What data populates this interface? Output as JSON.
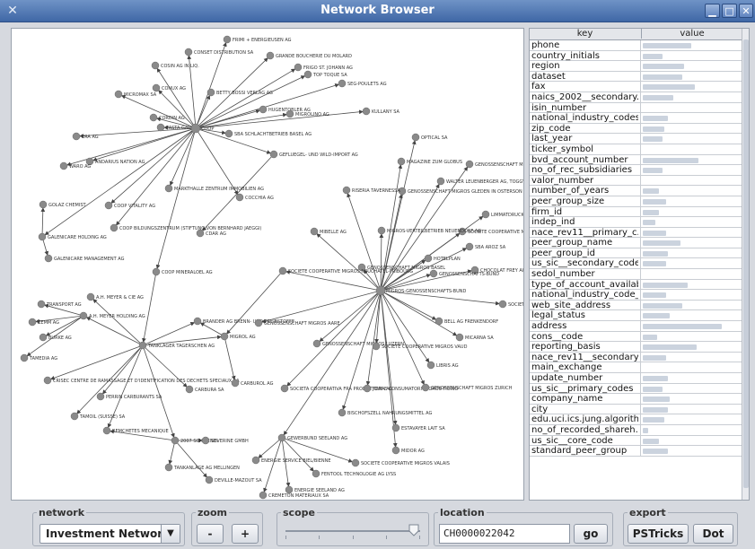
{
  "window": {
    "title": "Network Browser",
    "icon": "network-icon",
    "controls": [
      "minimize-icon",
      "maximize-icon",
      "close-icon"
    ]
  },
  "graph": {
    "nodes": [
      {
        "id": "n1",
        "label": "CONSET DISTRIBUTION SA"
      },
      {
        "id": "n2",
        "label": "FRIMI + ENERGIEUSEN AG"
      },
      {
        "id": "n3",
        "label": "COSIN AG IN LIQ."
      },
      {
        "id": "n4",
        "label": "GRANDE BOUCHERIE DU MOLARD"
      },
      {
        "id": "n5",
        "label": "FRIGO ST. JOHANN AG"
      },
      {
        "id": "n6",
        "label": "TOP TOQUE SA"
      },
      {
        "id": "n7",
        "label": "CONUX AG"
      },
      {
        "id": "n8",
        "label": "BETTY BOSSI VERLAG AG"
      },
      {
        "id": "n9",
        "label": "SEG-POULETS AG"
      },
      {
        "id": "n10",
        "label": "MICROMAX SA"
      },
      {
        "id": "n11",
        "label": "CORDIN AG"
      },
      {
        "id": "n12",
        "label": "PASTA GALA SA"
      },
      {
        "id": "n13",
        "label": "COOP"
      },
      {
        "id": "n14",
        "label": "HUGENTOBLER AG"
      },
      {
        "id": "n15",
        "label": "KULLANY SA"
      },
      {
        "id": "n16",
        "label": "MIGROLINO AG"
      },
      {
        "id": "n17",
        "label": "ERA AG"
      },
      {
        "id": "n18",
        "label": "SBA SCHLACHTBETRIEB BASEL AG"
      },
      {
        "id": "n19",
        "label": "OPTICAL SA"
      },
      {
        "id": "n20",
        "label": "ANDARIUS NATION AG"
      },
      {
        "id": "n21",
        "label": "WARO AG"
      },
      {
        "id": "n22",
        "label": "GEFLUEGEL- UND WILD-IMPORT AG"
      },
      {
        "id": "n23",
        "label": "MAGAZINE ZUM GLOBUS"
      },
      {
        "id": "n24",
        "label": "GENOSSENSCHAFT MIGROS OSTSCHWEIZ"
      },
      {
        "id": "n25",
        "label": "MARKTHALLE ZENTRUM IMMOBILIEN AG"
      },
      {
        "id": "n26",
        "label": "WALTER LEUENBERGER AG, TOGGWIL"
      },
      {
        "id": "n27",
        "label": "GENOSSENSCHAFT MIGROS GLEDEN IN OSTERSON"
      },
      {
        "id": "n28",
        "label": "RISERIA TAVERNESSA"
      },
      {
        "id": "n29",
        "label": "COCCHIA AG"
      },
      {
        "id": "n30",
        "label": "GOLAZ CHEMIST"
      },
      {
        "id": "n31",
        "label": "COOP VITALITY AG"
      },
      {
        "id": "n32",
        "label": "LIMMATDRUCK AG"
      },
      {
        "id": "n33",
        "label": "COOP BILDUNGSZENTRUM (STIFTUNG VON BERNHARD JAEGGI)"
      },
      {
        "id": "n34",
        "label": "CDAR AG"
      },
      {
        "id": "n35",
        "label": "GALENICARE HOLDING AG"
      },
      {
        "id": "n36",
        "label": "SOCIETE COOPERATIVE MIGROS GENEVE"
      },
      {
        "id": "n37",
        "label": "MIGROS-VERTEILBETRIEB NEUENDORF AG"
      },
      {
        "id": "n38",
        "label": "GALENICARE MANAGEMENT AG"
      },
      {
        "id": "n39",
        "label": "SBA AROZ SA"
      },
      {
        "id": "n40",
        "label": "MIBELLE AG"
      },
      {
        "id": "n41",
        "label": "COOP MINERALOEL AG"
      },
      {
        "id": "n42",
        "label": "HOTELPLAN"
      },
      {
        "id": "n43",
        "label": "CHOCOLAT FREY AG"
      },
      {
        "id": "n44",
        "label": "GENOSSENSCHAFT MIGROS BASEL"
      },
      {
        "id": "n45",
        "label": "GENOSSENSCHAFTS-BUND"
      },
      {
        "id": "n46",
        "label": "MIGROS-GENOSSENSCHAFTS-BUND"
      },
      {
        "id": "n47",
        "label": "TRANSPORT AG"
      },
      {
        "id": "n48",
        "label": "A.H. MEYER & CIE AG"
      },
      {
        "id": "n49",
        "label": "SOCIETE COOPERATIVE MIGROS NEUCHATEL-FRIBOURG"
      },
      {
        "id": "n50",
        "label": "ZEMM AG"
      },
      {
        "id": "n51",
        "label": "A.H. MEYER HOLDING AG"
      },
      {
        "id": "n52",
        "label": "BELL AG FRENKENDORF"
      },
      {
        "id": "n53",
        "label": "BURKE AG"
      },
      {
        "id": "n54",
        "label": "BRANDER AG BRENN- UND TREIBSTOFFE"
      },
      {
        "id": "n55",
        "label": "GENOSSENSCHAFT MIGROS AARE"
      },
      {
        "id": "n56",
        "label": "MICARNA SA"
      },
      {
        "id": "n57",
        "label": "TAMEDIA AG"
      },
      {
        "id": "n58",
        "label": "TANKLAGER TAGERSCHEN AG"
      },
      {
        "id": "n59",
        "label": "MIGROL AG"
      },
      {
        "id": "n60",
        "label": "GENOSSENSCHAFT MIGROS LUZERN"
      },
      {
        "id": "n61",
        "label": "SOCIETE COOPERATIVE MIGROS VAUD"
      },
      {
        "id": "n62",
        "label": "LIBRIS AG"
      },
      {
        "id": "n63",
        "label": "CRISEC CENTRE DE RAMASSAGE ET D'IDENTIFICATION DES DECHETS SPECIAUX SA"
      },
      {
        "id": "n64",
        "label": "CARBURA SA"
      },
      {
        "id": "n65",
        "label": "CARBUROL AG"
      },
      {
        "id": "n66",
        "label": "SOCIETA COOPERATIVA FRA PRODUTTORI E CONSUMATORI MIGROS-TICINO"
      },
      {
        "id": "n67",
        "label": "JOWA AG"
      },
      {
        "id": "n68",
        "label": "GENOSSENSCHAFT MIGROS ZURICH"
      },
      {
        "id": "n69",
        "label": "PERRIN CARBURANTS SA"
      },
      {
        "id": "n70",
        "label": "TAMOIL (SUISSE) SA"
      },
      {
        "id": "n71",
        "label": "BISCHOFSZELL NAHRUNGSMITTEL AG"
      },
      {
        "id": "n72",
        "label": "ESTAVAYER LAIT SA"
      },
      {
        "id": "n73",
        "label": "REMCHETES MECANIQUE"
      },
      {
        "id": "n74",
        "label": "2007 SCHWENDI"
      },
      {
        "id": "n75",
        "label": "SEVERINE GMBH"
      },
      {
        "id": "n76",
        "label": "GEWERBUND SEELAND AG"
      },
      {
        "id": "n77",
        "label": "MIDOR AG"
      },
      {
        "id": "n78",
        "label": "SOCIETE COOPERATIVE MIGROS VALAIS"
      },
      {
        "id": "n79",
        "label": "TANKANLAGE AG MELLINGEN"
      },
      {
        "id": "n80",
        "label": "ENERGIE SERVICE BIEL/BIENNE"
      },
      {
        "id": "n81",
        "label": "FENTOOL TECHNOLOGIE AG LYSS"
      },
      {
        "id": "n82",
        "label": "DEVILLE-MAZOUT SA"
      },
      {
        "id": "n83",
        "label": "ENERGIE SEELAND AG"
      },
      {
        "id": "n84",
        "label": "CREMETON MATERIAUX SA"
      },
      {
        "id": "n85",
        "label": "SOCIETE COOPERATIVE MIGROS"
      }
    ]
  },
  "table": {
    "columns": [
      "key",
      "value"
    ],
    "rows": [
      {
        "key": "phone"
      },
      {
        "key": "country_initials"
      },
      {
        "key": "region"
      },
      {
        "key": "dataset"
      },
      {
        "key": "fax"
      },
      {
        "key": "naics_2002__secondary..."
      },
      {
        "key": "isin_number"
      },
      {
        "key": "national_industry_codes..."
      },
      {
        "key": "zip_code"
      },
      {
        "key": "last_year"
      },
      {
        "key": "ticker_symbol"
      },
      {
        "key": "bvd_account_number"
      },
      {
        "key": "no_of_rec_subsidiaries"
      },
      {
        "key": "valor_number"
      },
      {
        "key": "number_of_years"
      },
      {
        "key": "peer_group_size"
      },
      {
        "key": "firm_id"
      },
      {
        "key": "indep_ind"
      },
      {
        "key": "nace_rev11__primary_c..."
      },
      {
        "key": "peer_group_name"
      },
      {
        "key": "peer_group_id"
      },
      {
        "key": "us_sic__secondary_codes"
      },
      {
        "key": "sedol_number"
      },
      {
        "key": "type_of_account_available"
      },
      {
        "key": "national_industry_code_..."
      },
      {
        "key": "web_site_address"
      },
      {
        "key": "legal_status"
      },
      {
        "key": "address"
      },
      {
        "key": "cons__code"
      },
      {
        "key": "reporting_basis"
      },
      {
        "key": "nace_rev11__secondary..."
      },
      {
        "key": "main_exchange"
      },
      {
        "key": "update_number"
      },
      {
        "key": "us_sic__primary_codes"
      },
      {
        "key": "company_name"
      },
      {
        "key": "city"
      },
      {
        "key": "edu.uci.ics.jung.algorith..."
      },
      {
        "key": "no_of_recorded_shareh..."
      },
      {
        "key": "us_sic__core_code"
      },
      {
        "key": "standard_peer_group"
      }
    ]
  },
  "controls": {
    "network": {
      "legend": "network",
      "selected": "Investment Network"
    },
    "zoom": {
      "legend": "zoom",
      "minus": "-",
      "plus": "+"
    },
    "scope": {
      "legend": "scope",
      "level": 0.95
    },
    "location": {
      "legend": "location",
      "value": "CH0000022042",
      "go": "go"
    },
    "export": {
      "legend": "export",
      "pstricks": "PSTricks",
      "dot": "Dot"
    }
  }
}
